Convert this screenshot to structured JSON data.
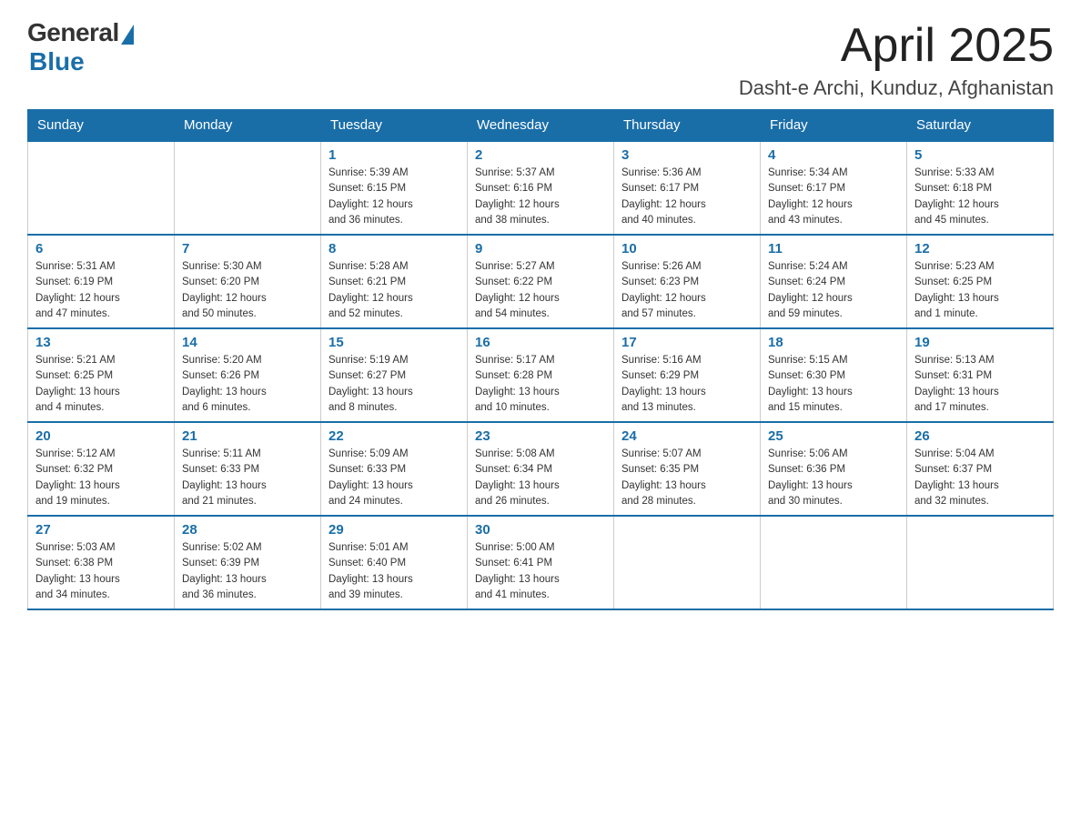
{
  "header": {
    "logo_general": "General",
    "logo_blue": "Blue",
    "month_title": "April 2025",
    "location": "Dasht-e Archi, Kunduz, Afghanistan"
  },
  "days_of_week": [
    "Sunday",
    "Monday",
    "Tuesday",
    "Wednesday",
    "Thursday",
    "Friday",
    "Saturday"
  ],
  "weeks": [
    [
      {
        "day": "",
        "info": ""
      },
      {
        "day": "",
        "info": ""
      },
      {
        "day": "1",
        "info": "Sunrise: 5:39 AM\nSunset: 6:15 PM\nDaylight: 12 hours\nand 36 minutes."
      },
      {
        "day": "2",
        "info": "Sunrise: 5:37 AM\nSunset: 6:16 PM\nDaylight: 12 hours\nand 38 minutes."
      },
      {
        "day": "3",
        "info": "Sunrise: 5:36 AM\nSunset: 6:17 PM\nDaylight: 12 hours\nand 40 minutes."
      },
      {
        "day": "4",
        "info": "Sunrise: 5:34 AM\nSunset: 6:17 PM\nDaylight: 12 hours\nand 43 minutes."
      },
      {
        "day": "5",
        "info": "Sunrise: 5:33 AM\nSunset: 6:18 PM\nDaylight: 12 hours\nand 45 minutes."
      }
    ],
    [
      {
        "day": "6",
        "info": "Sunrise: 5:31 AM\nSunset: 6:19 PM\nDaylight: 12 hours\nand 47 minutes."
      },
      {
        "day": "7",
        "info": "Sunrise: 5:30 AM\nSunset: 6:20 PM\nDaylight: 12 hours\nand 50 minutes."
      },
      {
        "day": "8",
        "info": "Sunrise: 5:28 AM\nSunset: 6:21 PM\nDaylight: 12 hours\nand 52 minutes."
      },
      {
        "day": "9",
        "info": "Sunrise: 5:27 AM\nSunset: 6:22 PM\nDaylight: 12 hours\nand 54 minutes."
      },
      {
        "day": "10",
        "info": "Sunrise: 5:26 AM\nSunset: 6:23 PM\nDaylight: 12 hours\nand 57 minutes."
      },
      {
        "day": "11",
        "info": "Sunrise: 5:24 AM\nSunset: 6:24 PM\nDaylight: 12 hours\nand 59 minutes."
      },
      {
        "day": "12",
        "info": "Sunrise: 5:23 AM\nSunset: 6:25 PM\nDaylight: 13 hours\nand 1 minute."
      }
    ],
    [
      {
        "day": "13",
        "info": "Sunrise: 5:21 AM\nSunset: 6:25 PM\nDaylight: 13 hours\nand 4 minutes."
      },
      {
        "day": "14",
        "info": "Sunrise: 5:20 AM\nSunset: 6:26 PM\nDaylight: 13 hours\nand 6 minutes."
      },
      {
        "day": "15",
        "info": "Sunrise: 5:19 AM\nSunset: 6:27 PM\nDaylight: 13 hours\nand 8 minutes."
      },
      {
        "day": "16",
        "info": "Sunrise: 5:17 AM\nSunset: 6:28 PM\nDaylight: 13 hours\nand 10 minutes."
      },
      {
        "day": "17",
        "info": "Sunrise: 5:16 AM\nSunset: 6:29 PM\nDaylight: 13 hours\nand 13 minutes."
      },
      {
        "day": "18",
        "info": "Sunrise: 5:15 AM\nSunset: 6:30 PM\nDaylight: 13 hours\nand 15 minutes."
      },
      {
        "day": "19",
        "info": "Sunrise: 5:13 AM\nSunset: 6:31 PM\nDaylight: 13 hours\nand 17 minutes."
      }
    ],
    [
      {
        "day": "20",
        "info": "Sunrise: 5:12 AM\nSunset: 6:32 PM\nDaylight: 13 hours\nand 19 minutes."
      },
      {
        "day": "21",
        "info": "Sunrise: 5:11 AM\nSunset: 6:33 PM\nDaylight: 13 hours\nand 21 minutes."
      },
      {
        "day": "22",
        "info": "Sunrise: 5:09 AM\nSunset: 6:33 PM\nDaylight: 13 hours\nand 24 minutes."
      },
      {
        "day": "23",
        "info": "Sunrise: 5:08 AM\nSunset: 6:34 PM\nDaylight: 13 hours\nand 26 minutes."
      },
      {
        "day": "24",
        "info": "Sunrise: 5:07 AM\nSunset: 6:35 PM\nDaylight: 13 hours\nand 28 minutes."
      },
      {
        "day": "25",
        "info": "Sunrise: 5:06 AM\nSunset: 6:36 PM\nDaylight: 13 hours\nand 30 minutes."
      },
      {
        "day": "26",
        "info": "Sunrise: 5:04 AM\nSunset: 6:37 PM\nDaylight: 13 hours\nand 32 minutes."
      }
    ],
    [
      {
        "day": "27",
        "info": "Sunrise: 5:03 AM\nSunset: 6:38 PM\nDaylight: 13 hours\nand 34 minutes."
      },
      {
        "day": "28",
        "info": "Sunrise: 5:02 AM\nSunset: 6:39 PM\nDaylight: 13 hours\nand 36 minutes."
      },
      {
        "day": "29",
        "info": "Sunrise: 5:01 AM\nSunset: 6:40 PM\nDaylight: 13 hours\nand 39 minutes."
      },
      {
        "day": "30",
        "info": "Sunrise: 5:00 AM\nSunset: 6:41 PM\nDaylight: 13 hours\nand 41 minutes."
      },
      {
        "day": "",
        "info": ""
      },
      {
        "day": "",
        "info": ""
      },
      {
        "day": "",
        "info": ""
      }
    ]
  ]
}
